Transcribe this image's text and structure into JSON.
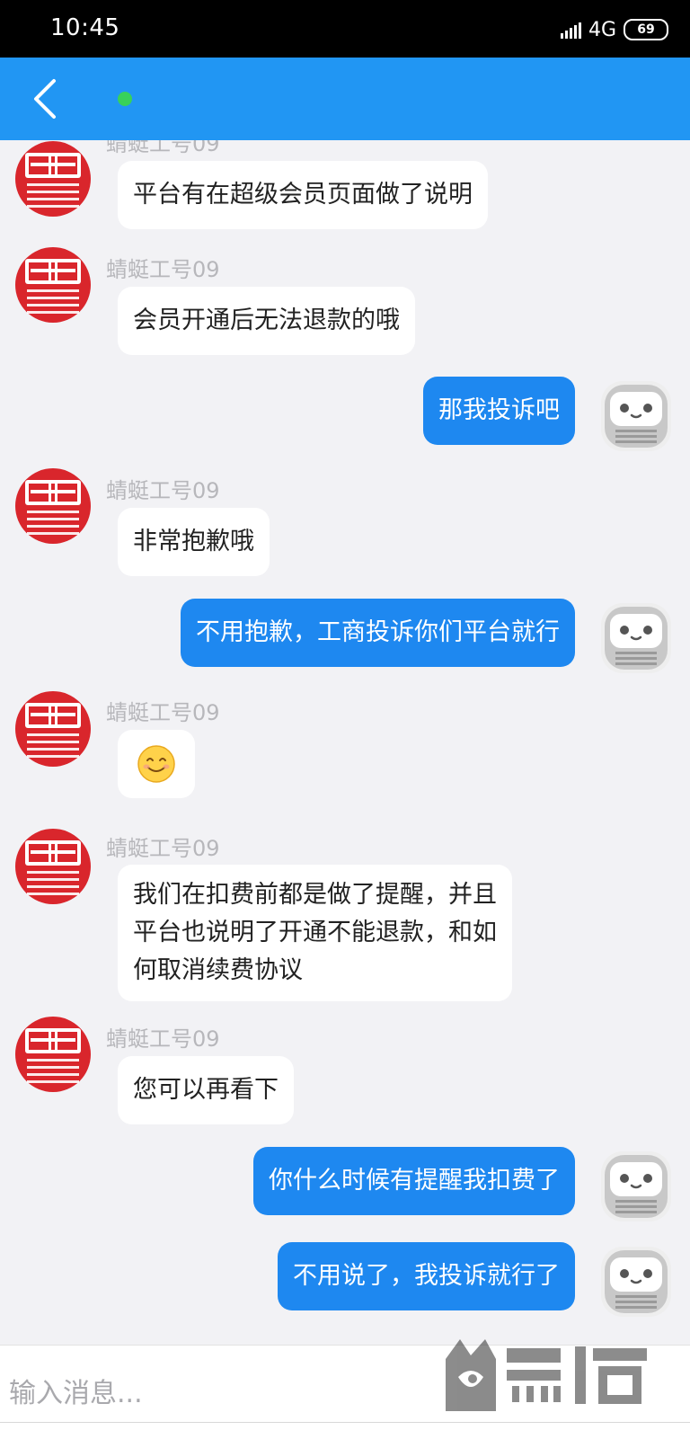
{
  "status_bar": {
    "time": "10:45",
    "network": "4G",
    "battery": "69",
    "icons": [
      "signal-icon",
      "battery-icon"
    ]
  },
  "header": {
    "back_icon": "chevron-left-icon",
    "online_indicator": "online-dot-icon",
    "colors": {
      "bar": "#2196f3",
      "online": "#38d15a"
    }
  },
  "chat": {
    "agent_name": "蜻蜓工号09",
    "messages": [
      {
        "from": "agent",
        "text": "平台有在超级会员页面做了说明"
      },
      {
        "from": "agent",
        "name": "蜻蜓工号09",
        "text": "会员开通后无法退款的哦"
      },
      {
        "from": "user",
        "text": "那我投诉吧"
      },
      {
        "from": "agent",
        "name": "蜻蜓工号09",
        "text": "非常抱歉哦"
      },
      {
        "from": "user",
        "text": "不用抱歉，工商投诉你们平台就行"
      },
      {
        "from": "agent",
        "name": "蜻蜓工号09",
        "emoji": "smiling-face-emoji"
      },
      {
        "from": "agent",
        "name": "蜻蜓工号09",
        "lines": [
          "我们在扣费前都是做了提醒，并且",
          "平台也说明了开通不能退款，和如",
          "何取消续费协议"
        ]
      },
      {
        "from": "agent",
        "name": "蜻蜓工号09",
        "text": "您可以再看下"
      },
      {
        "from": "user",
        "text": "你什么时候有提醒我扣费了"
      },
      {
        "from": "user",
        "text": "不用说了，我投诉就行了"
      }
    ],
    "colors": {
      "user_bubble": "#1e88f0",
      "agent_bubble": "#ffffff",
      "agent_avatar": "#d9262c",
      "user_avatar": "#c8c8c8"
    }
  },
  "input": {
    "placeholder": "输入消息..."
  },
  "watermark": {
    "logo_text": "黑猫",
    "brand": "BLACK CAT"
  }
}
